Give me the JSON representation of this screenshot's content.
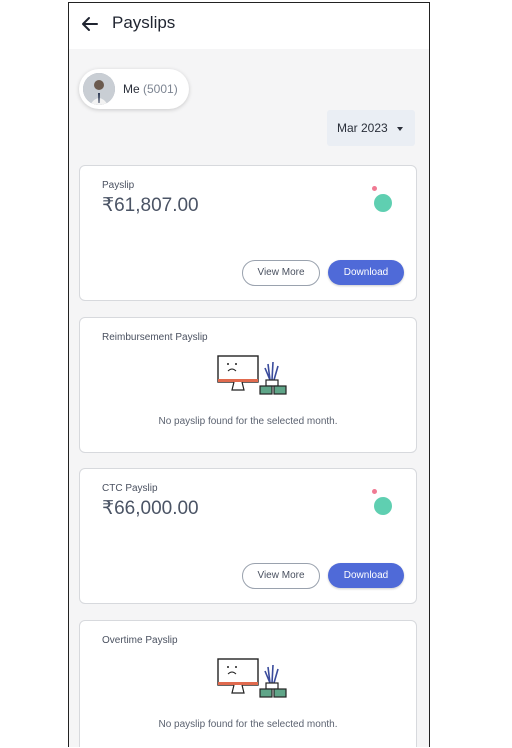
{
  "header": {
    "title": "Payslips",
    "back_icon": "arrow-left-icon"
  },
  "employee": {
    "name": "Me",
    "id": "(5001)"
  },
  "month_selector": {
    "value": "Mar 2023"
  },
  "cards": [
    {
      "title": "Payslip",
      "amount": "₹61,807.00",
      "view_label": "View More",
      "download_label": "Download"
    },
    {
      "title": "Reimbursement Payslip",
      "empty_message": "No payslip found for the selected month."
    },
    {
      "title": "CTC Payslip",
      "amount": "₹66,000.00",
      "view_label": "View More",
      "download_label": "Download"
    },
    {
      "title": "Overtime Payslip",
      "empty_message": "No payslip found for the selected month."
    }
  ],
  "colors": {
    "accent": "#4f6ad8",
    "dot_teal": "#5fcfb1",
    "dot_pink": "#f07a93"
  }
}
